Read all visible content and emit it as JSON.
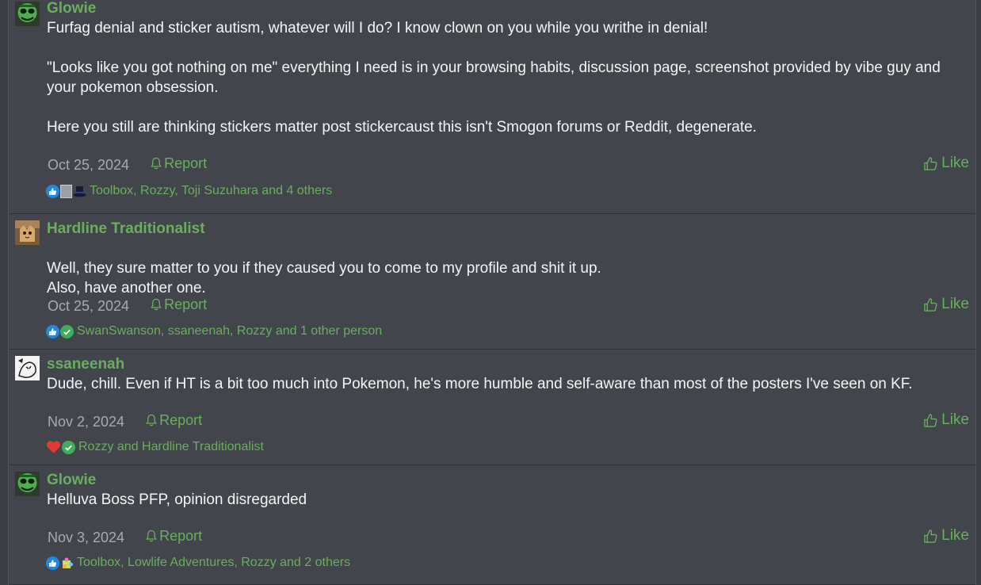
{
  "colors": {
    "accent": "#6aae5e",
    "background": "#42454c",
    "text": "#f5f5f5",
    "muted": "#a7abb0"
  },
  "posts": [
    {
      "author": "Glowie",
      "avatar_icon": "green-mask-avatar-icon",
      "paragraphs": [
        "Furfag denial and sticker autism, whatever will I do? I know clown on you while you writhe in denial!",
        "\"Looks like you got nothing on me\" everything I need is in your browsing habits, discussion page, screenshot provided by vibe guy and your pokemon obsession.",
        "Here you still are thinking stickers matter post stickercaust this isn't Smogon forums or Reddit, degenerate."
      ],
      "date": "Oct 25, 2024",
      "report_label": "Report",
      "like_label": "Like",
      "reaction_icons": [
        "thumbs-up-reaction-icon",
        "grey-square-reaction-icon",
        "top-hat-reaction-icon"
      ],
      "reactions_text": "Toolbox, Rozzy, Toji Suzuhara and 4 others"
    },
    {
      "author": "Hardline Traditionalist",
      "avatar_icon": "cat-avatar-icon",
      "paragraphs": [
        "Well, they sure matter to you if they caused you to come to my profile and shit it up.\nAlso, have another one."
      ],
      "date": "Oct 25, 2024",
      "report_label": "Report",
      "like_label": "Like",
      "reaction_icons": [
        "thumbs-up-reaction-icon",
        "checkmark-reaction-icon"
      ],
      "reactions_text": "SwanSwanson, ssaneenah, Rozzy and 1 other person"
    },
    {
      "author": "ssaneenah",
      "avatar_icon": "sketch-avatar-icon",
      "paragraphs": [
        "Dude, chill. Even if HT is a bit too much into Pokemon, he's more humble and self-aware than most of the posters I've seen on KF."
      ],
      "date": "Nov 2, 2024",
      "report_label": "Report",
      "like_label": "Like",
      "reaction_icons": [
        "heart-reaction-icon",
        "checkmark-reaction-icon"
      ],
      "reactions_text": "Rozzy and Hardline Traditionalist"
    },
    {
      "author": "Glowie",
      "avatar_icon": "green-mask-avatar-icon",
      "paragraphs": [
        "Helluva Boss PFP, opinion disregarded"
      ],
      "date": "Nov 3, 2024",
      "report_label": "Report",
      "like_label": "Like",
      "reaction_icons": [
        "thumbs-up-reaction-icon",
        "puzzle-reaction-icon"
      ],
      "reactions_text": "Toolbox, Lowlife Adventures, Rozzy and 2 others"
    }
  ]
}
